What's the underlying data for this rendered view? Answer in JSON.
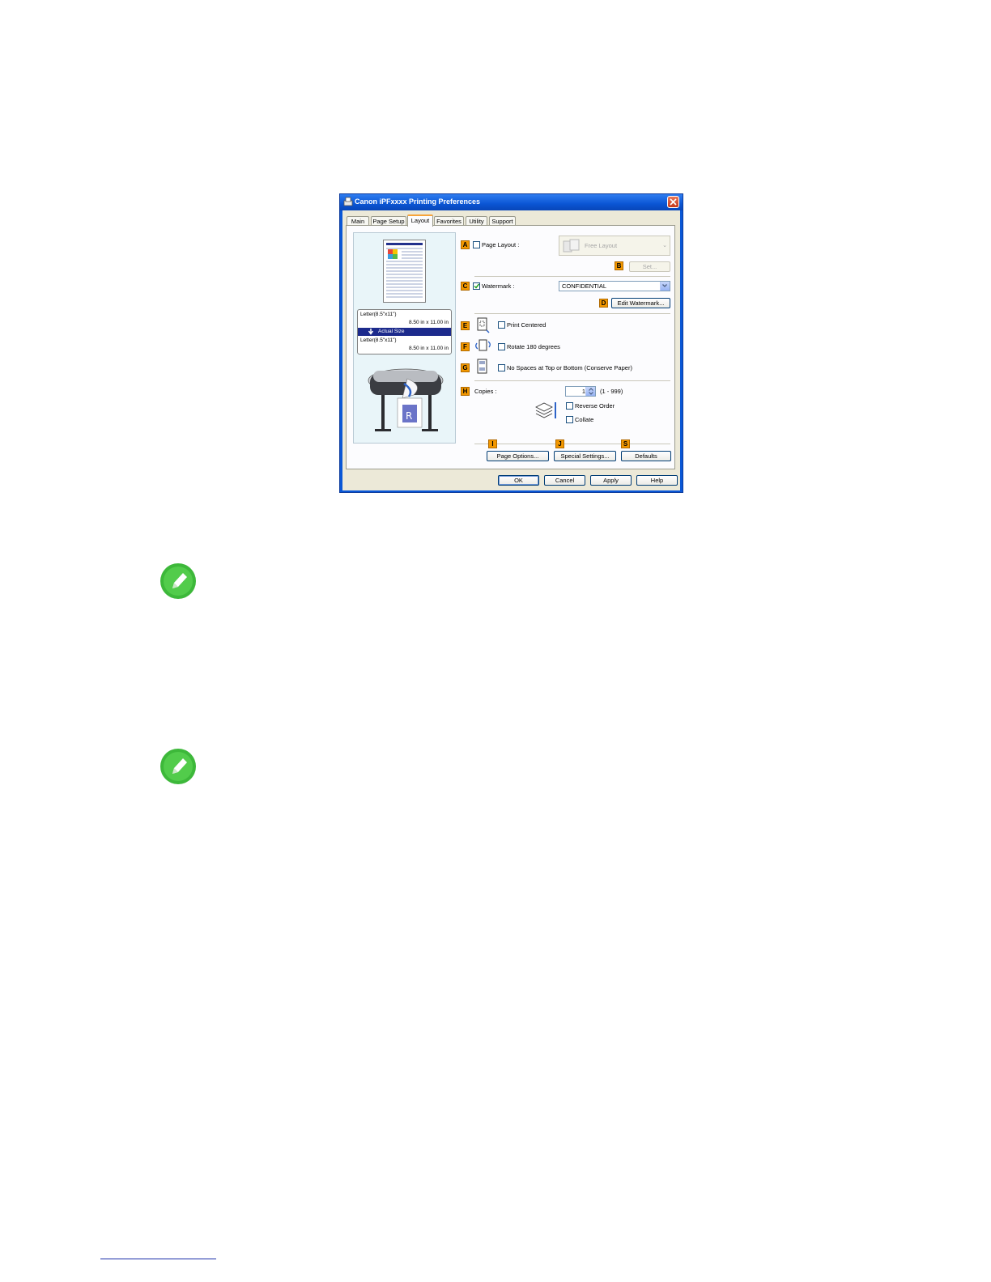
{
  "window": {
    "title": "Canon iPFxxxx Printing Preferences"
  },
  "tabs": [
    "Main",
    "Page Setup",
    "Layout",
    "Favorites",
    "Utility",
    "Support"
  ],
  "active_tab": "Layout",
  "preview": {
    "paper_size_1": "Letter(8.5\"x11\")",
    "paper_dims_1": "8.50 in x 11.00 in",
    "mode": "Actual Size",
    "paper_size_2": "Letter(8.5\"x11\")",
    "paper_dims_2": "8.50 in x 11.00 in"
  },
  "markers": {
    "A": "A",
    "B": "B",
    "C": "C",
    "D": "D",
    "E": "E",
    "F": "F",
    "G": "G",
    "H": "H",
    "I": "I",
    "J": "J",
    "S": "S"
  },
  "page_layout": {
    "label": "Page Layout :",
    "checked": false,
    "value": "Free Layout",
    "set_button": "Set..."
  },
  "watermark": {
    "label": "Watermark :",
    "checked": true,
    "value": "CONFIDENTIAL",
    "edit_button": "Edit Watermark..."
  },
  "print_centered": {
    "label": "Print Centered",
    "checked": false
  },
  "rotate": {
    "label": "Rotate 180 degrees",
    "checked": false
  },
  "no_spaces": {
    "label": "No Spaces at Top or Bottom (Conserve Paper)",
    "checked": false
  },
  "copies": {
    "label": "Copies :",
    "value": "1",
    "range": "(1 - 999)",
    "reverse_order": "Reverse Order",
    "collate": "Collate"
  },
  "buttons": {
    "page_options": "Page Options...",
    "special_settings": "Special Settings...",
    "defaults": "Defaults",
    "ok": "OK",
    "cancel": "Cancel",
    "apply": "Apply",
    "help": "Help"
  },
  "colors": {
    "marker_orange": "#f39800",
    "title_blue": "#0a55d4",
    "note_green": "#3db83a"
  }
}
